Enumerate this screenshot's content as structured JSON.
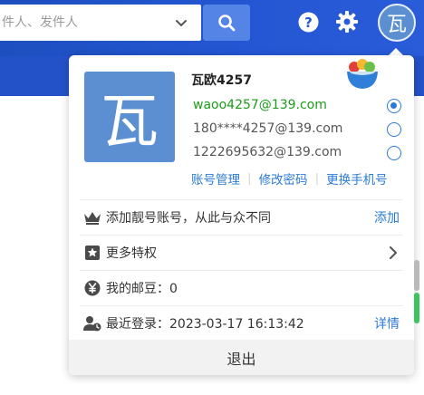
{
  "search": {
    "placeholder": "件人、发件人"
  },
  "header": {
    "avatar_char": "瓦"
  },
  "panel": {
    "avatar_char": "瓦",
    "user_name": "瓦欧4257",
    "accounts": [
      {
        "label": "waoo4257@139.com",
        "selected": true
      },
      {
        "label": "180****4257@139.com",
        "selected": false
      },
      {
        "label": "1222695632@139.com",
        "selected": false
      }
    ],
    "links": [
      "账号管理",
      "修改密码",
      "更换手机号"
    ],
    "rows": [
      {
        "text": "添加靓号账号，从此与众不同",
        "action": "添加"
      },
      {
        "text": "更多特权"
      },
      {
        "text": "我的邮豆：0"
      },
      {
        "text": "最近登录：2023-03-17 16:13:42",
        "action": "详情"
      }
    ],
    "logout_label": "退出"
  },
  "colors": {
    "topbar": "#2456d3",
    "accent_link": "#2b7bd6",
    "active_account": "#1a9d1a",
    "avatar_bg": "#5b8fd1"
  },
  "icons": [
    "chevron-down-icon",
    "search-icon",
    "help-icon",
    "gear-icon",
    "bowl-icon",
    "crown-icon",
    "star-badge-icon",
    "yen-coin-icon",
    "user-clock-icon",
    "chevron-right-icon"
  ]
}
